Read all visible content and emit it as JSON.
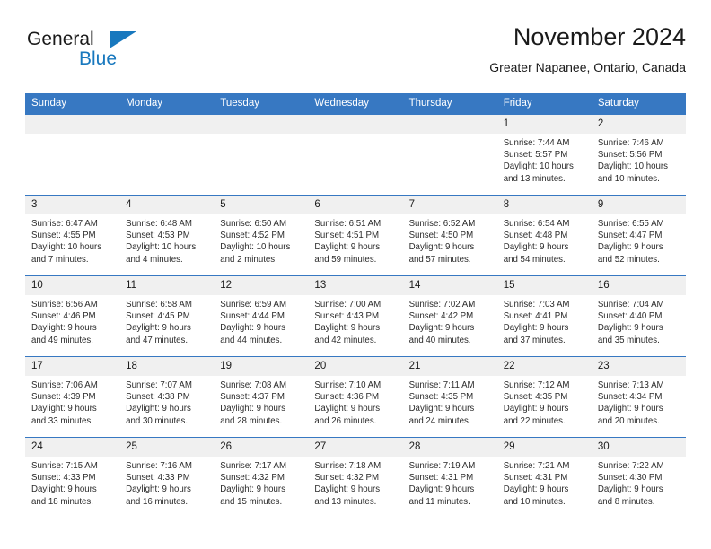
{
  "brand": {
    "name_top": "General",
    "name_bottom": "Blue",
    "accent_color": "#1878be"
  },
  "header": {
    "title": "November 2024",
    "subtitle": "Greater Napanee, Ontario, Canada"
  },
  "theme": {
    "header_bg": "#3778c2",
    "daynum_bg": "#f0f0f0",
    "text": "#1a1a1a"
  },
  "calendar": {
    "weekday_headers": [
      "Sunday",
      "Monday",
      "Tuesday",
      "Wednesday",
      "Thursday",
      "Friday",
      "Saturday"
    ],
    "weeks": [
      [
        {
          "day": "",
          "lines": []
        },
        {
          "day": "",
          "lines": []
        },
        {
          "day": "",
          "lines": []
        },
        {
          "day": "",
          "lines": []
        },
        {
          "day": "",
          "lines": []
        },
        {
          "day": "1",
          "lines": [
            "Sunrise: 7:44 AM",
            "Sunset: 5:57 PM",
            "Daylight: 10 hours",
            "and 13 minutes."
          ]
        },
        {
          "day": "2",
          "lines": [
            "Sunrise: 7:46 AM",
            "Sunset: 5:56 PM",
            "Daylight: 10 hours",
            "and 10 minutes."
          ]
        }
      ],
      [
        {
          "day": "3",
          "lines": [
            "Sunrise: 6:47 AM",
            "Sunset: 4:55 PM",
            "Daylight: 10 hours",
            "and 7 minutes."
          ]
        },
        {
          "day": "4",
          "lines": [
            "Sunrise: 6:48 AM",
            "Sunset: 4:53 PM",
            "Daylight: 10 hours",
            "and 4 minutes."
          ]
        },
        {
          "day": "5",
          "lines": [
            "Sunrise: 6:50 AM",
            "Sunset: 4:52 PM",
            "Daylight: 10 hours",
            "and 2 minutes."
          ]
        },
        {
          "day": "6",
          "lines": [
            "Sunrise: 6:51 AM",
            "Sunset: 4:51 PM",
            "Daylight: 9 hours",
            "and 59 minutes."
          ]
        },
        {
          "day": "7",
          "lines": [
            "Sunrise: 6:52 AM",
            "Sunset: 4:50 PM",
            "Daylight: 9 hours",
            "and 57 minutes."
          ]
        },
        {
          "day": "8",
          "lines": [
            "Sunrise: 6:54 AM",
            "Sunset: 4:48 PM",
            "Daylight: 9 hours",
            "and 54 minutes."
          ]
        },
        {
          "day": "9",
          "lines": [
            "Sunrise: 6:55 AM",
            "Sunset: 4:47 PM",
            "Daylight: 9 hours",
            "and 52 minutes."
          ]
        }
      ],
      [
        {
          "day": "10",
          "lines": [
            "Sunrise: 6:56 AM",
            "Sunset: 4:46 PM",
            "Daylight: 9 hours",
            "and 49 minutes."
          ]
        },
        {
          "day": "11",
          "lines": [
            "Sunrise: 6:58 AM",
            "Sunset: 4:45 PM",
            "Daylight: 9 hours",
            "and 47 minutes."
          ]
        },
        {
          "day": "12",
          "lines": [
            "Sunrise: 6:59 AM",
            "Sunset: 4:44 PM",
            "Daylight: 9 hours",
            "and 44 minutes."
          ]
        },
        {
          "day": "13",
          "lines": [
            "Sunrise: 7:00 AM",
            "Sunset: 4:43 PM",
            "Daylight: 9 hours",
            "and 42 minutes."
          ]
        },
        {
          "day": "14",
          "lines": [
            "Sunrise: 7:02 AM",
            "Sunset: 4:42 PM",
            "Daylight: 9 hours",
            "and 40 minutes."
          ]
        },
        {
          "day": "15",
          "lines": [
            "Sunrise: 7:03 AM",
            "Sunset: 4:41 PM",
            "Daylight: 9 hours",
            "and 37 minutes."
          ]
        },
        {
          "day": "16",
          "lines": [
            "Sunrise: 7:04 AM",
            "Sunset: 4:40 PM",
            "Daylight: 9 hours",
            "and 35 minutes."
          ]
        }
      ],
      [
        {
          "day": "17",
          "lines": [
            "Sunrise: 7:06 AM",
            "Sunset: 4:39 PM",
            "Daylight: 9 hours",
            "and 33 minutes."
          ]
        },
        {
          "day": "18",
          "lines": [
            "Sunrise: 7:07 AM",
            "Sunset: 4:38 PM",
            "Daylight: 9 hours",
            "and 30 minutes."
          ]
        },
        {
          "day": "19",
          "lines": [
            "Sunrise: 7:08 AM",
            "Sunset: 4:37 PM",
            "Daylight: 9 hours",
            "and 28 minutes."
          ]
        },
        {
          "day": "20",
          "lines": [
            "Sunrise: 7:10 AM",
            "Sunset: 4:36 PM",
            "Daylight: 9 hours",
            "and 26 minutes."
          ]
        },
        {
          "day": "21",
          "lines": [
            "Sunrise: 7:11 AM",
            "Sunset: 4:35 PM",
            "Daylight: 9 hours",
            "and 24 minutes."
          ]
        },
        {
          "day": "22",
          "lines": [
            "Sunrise: 7:12 AM",
            "Sunset: 4:35 PM",
            "Daylight: 9 hours",
            "and 22 minutes."
          ]
        },
        {
          "day": "23",
          "lines": [
            "Sunrise: 7:13 AM",
            "Sunset: 4:34 PM",
            "Daylight: 9 hours",
            "and 20 minutes."
          ]
        }
      ],
      [
        {
          "day": "24",
          "lines": [
            "Sunrise: 7:15 AM",
            "Sunset: 4:33 PM",
            "Daylight: 9 hours",
            "and 18 minutes."
          ]
        },
        {
          "day": "25",
          "lines": [
            "Sunrise: 7:16 AM",
            "Sunset: 4:33 PM",
            "Daylight: 9 hours",
            "and 16 minutes."
          ]
        },
        {
          "day": "26",
          "lines": [
            "Sunrise: 7:17 AM",
            "Sunset: 4:32 PM",
            "Daylight: 9 hours",
            "and 15 minutes."
          ]
        },
        {
          "day": "27",
          "lines": [
            "Sunrise: 7:18 AM",
            "Sunset: 4:32 PM",
            "Daylight: 9 hours",
            "and 13 minutes."
          ]
        },
        {
          "day": "28",
          "lines": [
            "Sunrise: 7:19 AM",
            "Sunset: 4:31 PM",
            "Daylight: 9 hours",
            "and 11 minutes."
          ]
        },
        {
          "day": "29",
          "lines": [
            "Sunrise: 7:21 AM",
            "Sunset: 4:31 PM",
            "Daylight: 9 hours",
            "and 10 minutes."
          ]
        },
        {
          "day": "30",
          "lines": [
            "Sunrise: 7:22 AM",
            "Sunset: 4:30 PM",
            "Daylight: 9 hours",
            "and 8 minutes."
          ]
        }
      ]
    ]
  }
}
